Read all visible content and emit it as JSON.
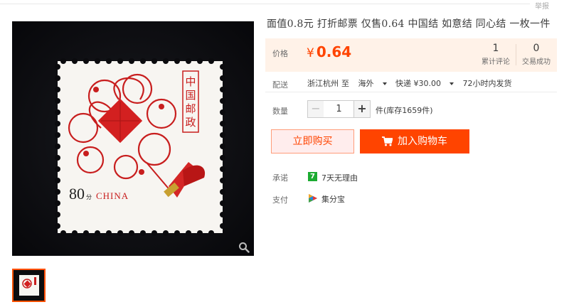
{
  "header": {
    "report_label": "举报"
  },
  "product": {
    "title": "面值0.8元 打折邮票 仅售0.64 中国结 如意结 同心结 一枚一件",
    "image": {
      "stamp_org": "中国邮政",
      "stamp_value": "80",
      "stamp_unit": "分",
      "stamp_country": "CHINA"
    }
  },
  "price": {
    "label": "价格",
    "currency": "¥",
    "value": "0.64",
    "stats": [
      {
        "num": "1",
        "label": "累计评论"
      },
      {
        "num": "0",
        "label": "交易成功"
      }
    ]
  },
  "shipping": {
    "label": "配送",
    "from": "浙江杭州",
    "to_word": "至",
    "destination": "海外",
    "method": "快递 ¥30.00",
    "time": "72小时内发货"
  },
  "quantity": {
    "label": "数量",
    "value": "1",
    "minus": "−",
    "plus": "+",
    "stock": "件(库存1659件)"
  },
  "actions": {
    "buy_now": "立即购买",
    "add_to_cart": "加入购物车"
  },
  "promise": {
    "label": "承诺",
    "icon_text": "7",
    "text": "7天无理由"
  },
  "payment": {
    "label": "支付",
    "text": "集分宝"
  },
  "colors": {
    "accent": "#ff4400",
    "price_bg": "#fff2e8",
    "promise_green": "#1cab31"
  }
}
